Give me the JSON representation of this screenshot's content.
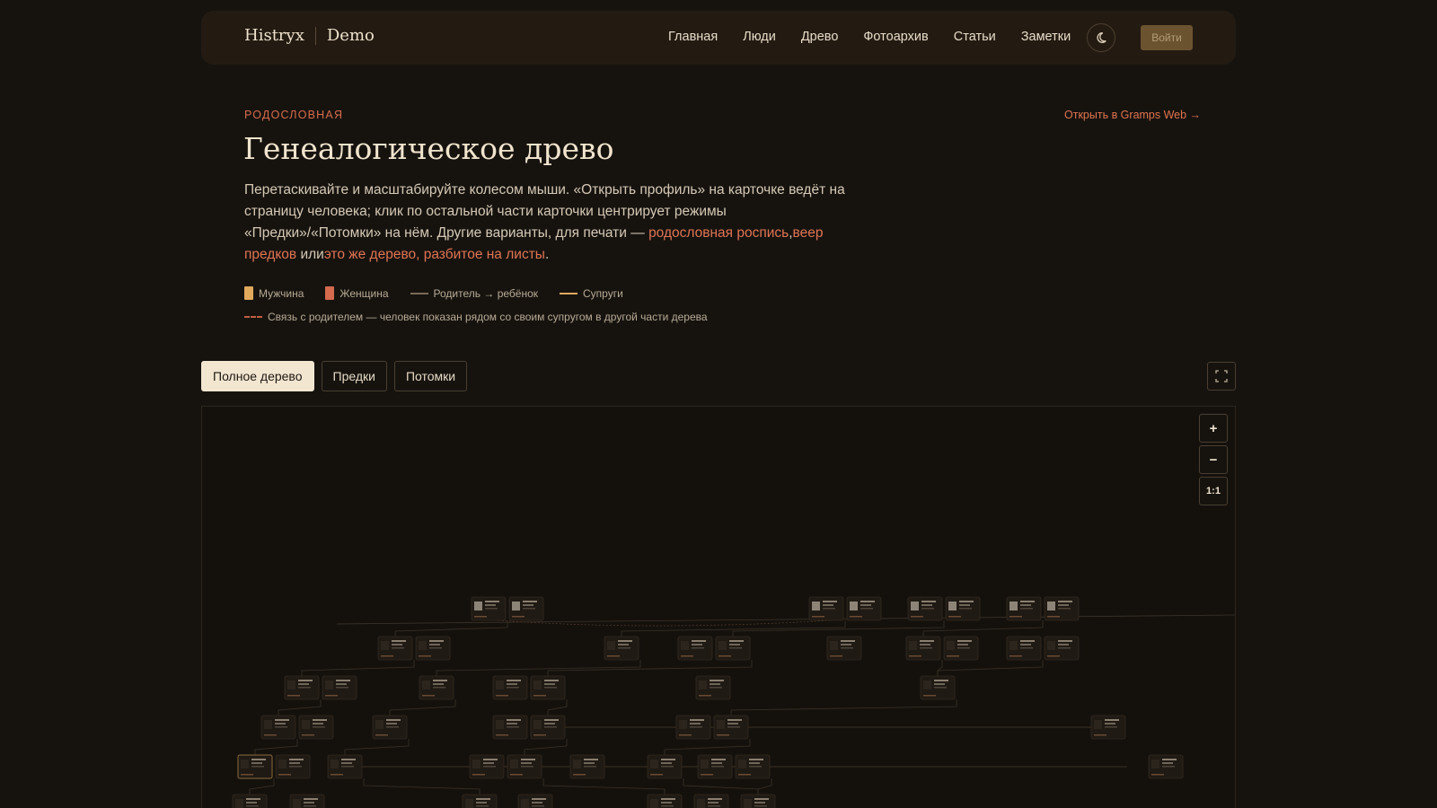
{
  "header": {
    "brand": "Histryx",
    "brand_sub": "Demo",
    "nav": [
      "Главная",
      "Люди",
      "Древо",
      "Фотоархив",
      "Статьи",
      "Заметки"
    ],
    "theme_icon": "moon-icon",
    "login_label": "Войти"
  },
  "intro": {
    "eyebrow": "РОДОСЛОВНАЯ",
    "gramps_link": "Открыть в Gramps Web →",
    "title": "Генеалогическое древо",
    "desc_text": "Перетаскивайте и масштабируйте колесом мыши. «Открыть профиль» на карточке ведёт на страницу человека; клик по остальной части карточки центрирует режимы «Предки»/«Потомки» на нём. Другие варианты, для печати — ",
    "link1": "родословная роспись",
    "sep1": ",",
    "link2": "веер предков",
    "sep2": " или",
    "link3": "это же дерево, разбитое на листы",
    "end": "."
  },
  "legend": {
    "male": "Мужчина",
    "female": "Женщина",
    "parent_child": "Родитель → ребёнок",
    "spouses": "Супруги",
    "dashed_note": "Связь с родителем — человек показан рядом со своим супругом в другой части дерева",
    "colors": {
      "male": "#e0a95c",
      "female": "#d46a4e",
      "parent_line": "#7a6c58",
      "spouse_line": "#e0a95c",
      "dashed": "#c0603f"
    }
  },
  "modes": [
    "Полное дерево",
    "Предки",
    "Потомки"
  ],
  "active_mode": 0,
  "zoom_controls": {
    "zoom_in": "+",
    "zoom_out": "−",
    "reset": "1:1"
  }
}
